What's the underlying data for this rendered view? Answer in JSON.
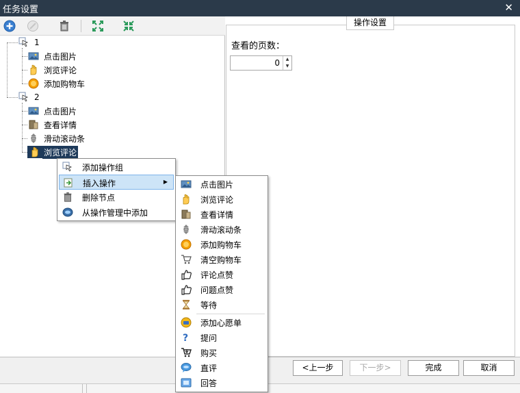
{
  "window": {
    "title": "任务设置",
    "close_label": "✕"
  },
  "toolbar": {
    "buttons": [
      {
        "name": "add-icon"
      },
      {
        "name": "disabled-icon"
      },
      {
        "name": "delete-icon"
      },
      {
        "name": "expand-icon"
      },
      {
        "name": "collapse-icon"
      }
    ]
  },
  "tree": {
    "group1": {
      "label": "1",
      "items": [
        "点击图片",
        "浏览评论",
        "添加购物车"
      ]
    },
    "group2": {
      "label": "2",
      "items": [
        "点击图片",
        "查看详情",
        "滑动滚动条",
        "浏览评论"
      ]
    }
  },
  "panel": {
    "group_title": "操作设置",
    "field_label": "查看的页数：",
    "spin_value": "0"
  },
  "footer": {
    "prev": "<上一步",
    "next": "下一步>",
    "finish": "完成",
    "cancel": "取消"
  },
  "context_menu": {
    "items": [
      "添加操作组",
      "插入操作",
      "删除节点",
      "从操作管理中添加"
    ],
    "submenu_arrow": "▶"
  },
  "submenu": {
    "items": [
      "点击图片",
      "浏览评论",
      "查看详情",
      "滑动滚动条",
      "添加购物车",
      "清空购物车",
      "评论点赞",
      "问题点赞",
      "等待",
      "添加心愿单",
      "提问",
      "购买",
      "直评",
      "回答"
    ]
  },
  "colors": {
    "title_bar": "#2b3a4a",
    "selected": "#1e3a5a",
    "menu_highlight": "#cde4f7"
  }
}
